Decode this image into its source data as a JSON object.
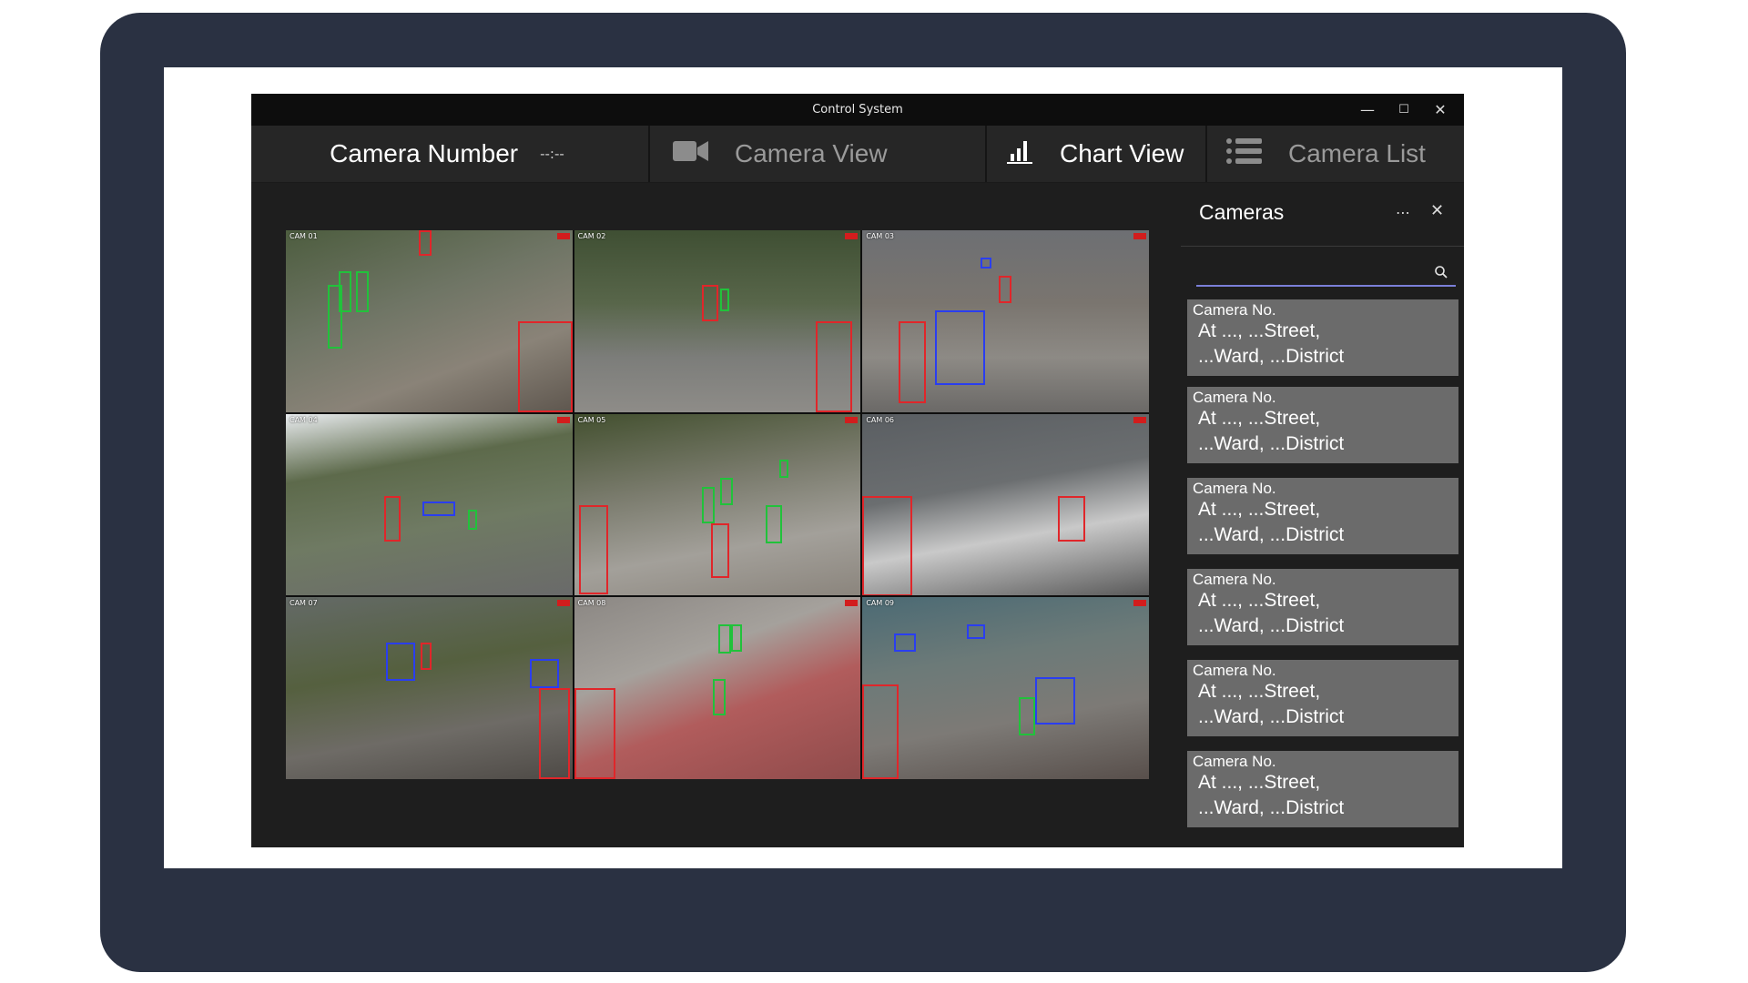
{
  "window": {
    "title": "Control System",
    "minimize_icon": "minimize-icon",
    "maximize_icon": "maximize-icon",
    "close_icon": "close-icon"
  },
  "navbar": {
    "camera_number_label": "Camera Number",
    "camera_number_value": "--:--",
    "tabs": [
      {
        "label": "Camera View",
        "icon": "video-camera-icon",
        "active": false
      },
      {
        "label": "Chart View",
        "icon": "bar-chart-icon",
        "active": true
      },
      {
        "label": "Camera List",
        "icon": "list-icon",
        "active": false
      }
    ]
  },
  "grid": {
    "feeds": [
      {
        "id": "feed-1",
        "scene": "sidewalk pedestrians"
      },
      {
        "id": "feed-2",
        "scene": "park walkway"
      },
      {
        "id": "feed-3",
        "scene": "street with car"
      },
      {
        "id": "feed-4",
        "scene": "bus stop road"
      },
      {
        "id": "feed-5",
        "scene": "park plaza"
      },
      {
        "id": "feed-6",
        "scene": "crosswalk"
      },
      {
        "id": "feed-7",
        "scene": "tree-lined street"
      },
      {
        "id": "feed-8",
        "scene": "red path stone wall"
      },
      {
        "id": "feed-9",
        "scene": "busy road"
      }
    ],
    "detection_colors": {
      "person": "#21c23b",
      "alert": "#e0262a",
      "vehicle": "#2a3ef0"
    }
  },
  "panel": {
    "title": "Cameras",
    "more_icon": "more-horizontal-icon",
    "close_icon": "close-icon",
    "search": {
      "placeholder": "",
      "icon": "search-icon"
    },
    "cameras": [
      {
        "no": "Camera No.",
        "line1": "At ..., ...Street,",
        "line2": "...Ward, ...District"
      },
      {
        "no": "Camera No.",
        "line1": "At ..., ...Street,",
        "line2": "...Ward, ...District"
      },
      {
        "no": "Camera No.",
        "line1": "At ..., ...Street,",
        "line2": "...Ward, ...District"
      },
      {
        "no": "Camera No.",
        "line1": "At ..., ...Street,",
        "line2": "...Ward, ...District"
      },
      {
        "no": "Camera No.",
        "line1": "At ..., ...Street,",
        "line2": "...Ward, ...District"
      },
      {
        "no": "Camera No.",
        "line1": "At ..., ...Street,",
        "line2": "...Ward, ...District"
      }
    ]
  },
  "colors": {
    "bezel": "#2a3142",
    "app_bg": "#1e1e1e",
    "titlebar": "#0d0d0d",
    "navbar": "#262626",
    "card": "#6b6b6b",
    "search_underline": "#7a7fd8"
  }
}
